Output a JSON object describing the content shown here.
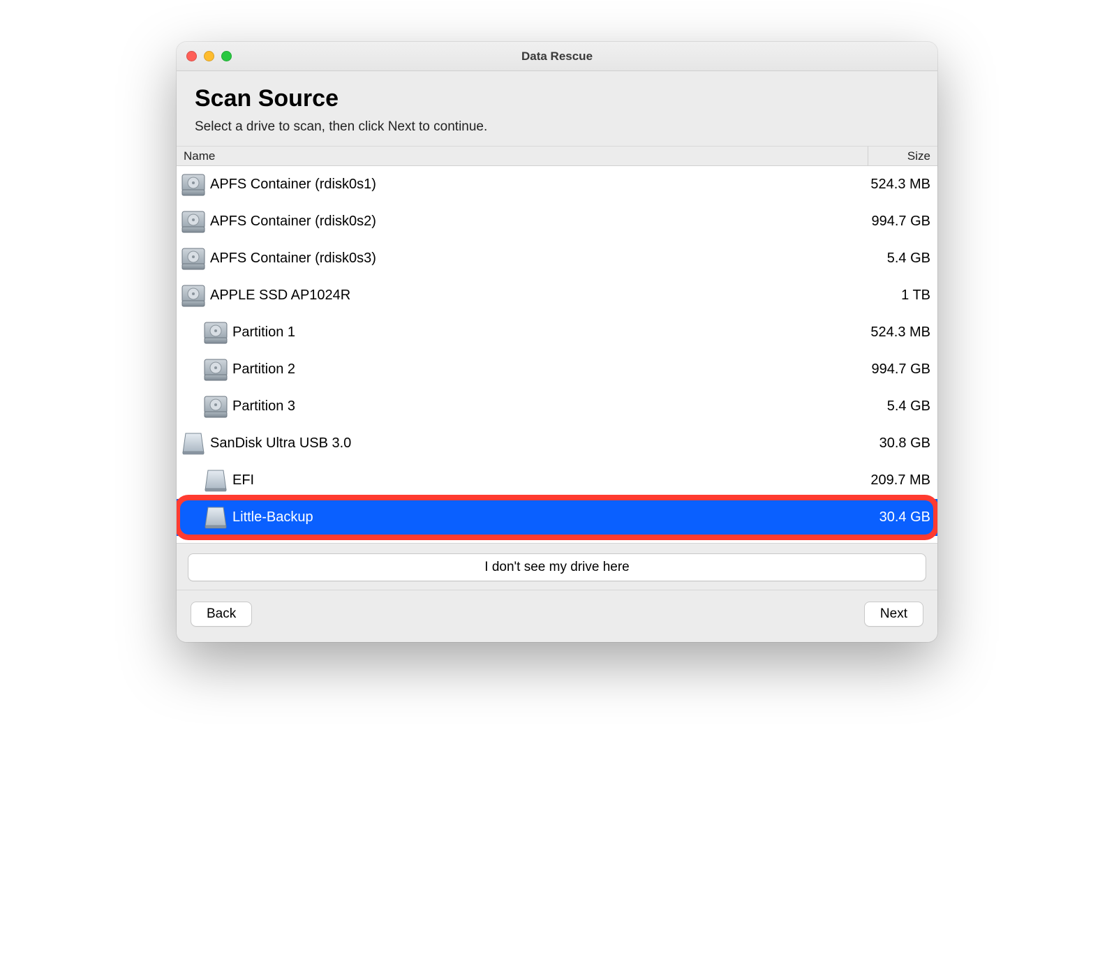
{
  "window": {
    "title": "Data Rescue"
  },
  "header": {
    "title": "Scan Source",
    "subtitle": "Select a drive to scan, then click Next to continue."
  },
  "columns": {
    "name": "Name",
    "size": "Size"
  },
  "drives": [
    {
      "name": "APFS Container (rdisk0s1)",
      "size": "524.3 MB",
      "icon": "hdd",
      "indent": 0,
      "selected": false
    },
    {
      "name": "APFS Container (rdisk0s2)",
      "size": "994.7 GB",
      "icon": "hdd",
      "indent": 0,
      "selected": false
    },
    {
      "name": "APFS Container (rdisk0s3)",
      "size": "5.4 GB",
      "icon": "hdd",
      "indent": 0,
      "selected": false
    },
    {
      "name": "APPLE SSD AP1024R",
      "size": "1 TB",
      "icon": "hdd",
      "indent": 0,
      "selected": false
    },
    {
      "name": "Partition 1",
      "size": "524.3 MB",
      "icon": "hdd",
      "indent": 1,
      "selected": false
    },
    {
      "name": "Partition 2",
      "size": "994.7 GB",
      "icon": "hdd",
      "indent": 1,
      "selected": false
    },
    {
      "name": "Partition 3",
      "size": "5.4 GB",
      "icon": "hdd",
      "indent": 1,
      "selected": false
    },
    {
      "name": "SanDisk Ultra USB 3.0",
      "size": "30.8 GB",
      "icon": "external",
      "indent": 0,
      "selected": false
    },
    {
      "name": "EFI",
      "size": "209.7 MB",
      "icon": "external",
      "indent": 1,
      "selected": false
    },
    {
      "name": "Little-Backup",
      "size": "30.4 GB",
      "icon": "external",
      "indent": 1,
      "selected": true,
      "highlighted": true
    }
  ],
  "footer": {
    "help_button": "I don't see my drive here",
    "back_button": "Back",
    "next_button": "Next"
  }
}
